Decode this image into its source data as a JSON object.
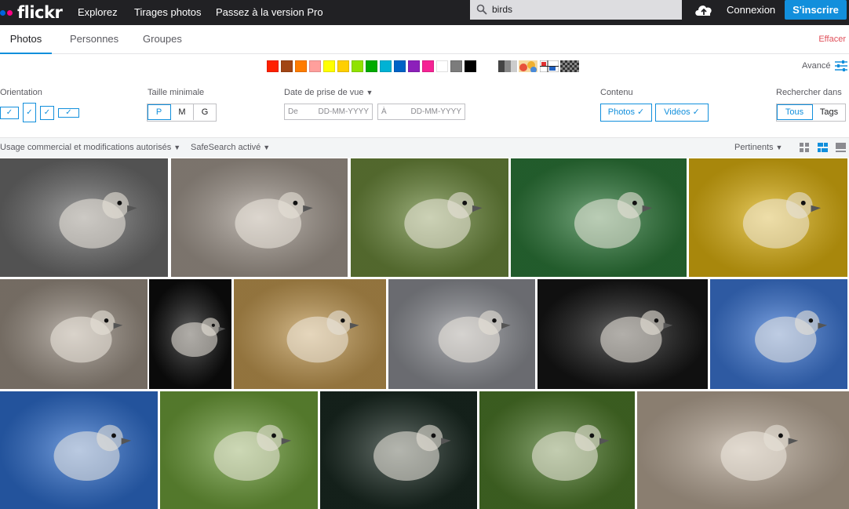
{
  "header": {
    "logo_text": "flickr",
    "nav": [
      "Explorez",
      "Tirages photos",
      "Passez à la version Pro"
    ],
    "search_value": "birds",
    "login": "Connexion",
    "signup": "S'inscrire",
    "brand_colors": {
      "blue_dot": "#0063dc",
      "pink_dot": "#ff0084",
      "accent": "#128fdc"
    }
  },
  "tabs": [
    "Photos",
    "Personnes",
    "Groupes"
  ],
  "clear_label": "Effacer",
  "color_filter": {
    "swatches": [
      "#ff2000",
      "#a24615",
      "#ff7c00",
      "#ff9f9c",
      "#ffff00",
      "#ffcf00",
      "#90e200",
      "#00ab00",
      "#00b2d4",
      "#0062c6",
      "#8c20ba",
      "#f52394",
      "#ffffff",
      "#7c7c7c",
      "#000000"
    ],
    "pattern_icons": [
      "grayscale-icon",
      "colorful-icon",
      "pattern-icon",
      "checker-icon"
    ]
  },
  "advanced_label": "Avancé",
  "filters": {
    "orientation_label": "Orientation",
    "size_label": "Taille minimale",
    "size_options": [
      "P",
      "M",
      "G"
    ],
    "date_label": "Date de prise de vue",
    "date_from_prefix": "De",
    "date_to_prefix": "À",
    "date_format": "DD-MM-YYYY",
    "content_label": "Contenu",
    "content_photos": "Photos",
    "content_videos": "Vidéos",
    "search_in_label": "Rechercher dans",
    "search_in_options": [
      "Tous",
      "Tags"
    ]
  },
  "bar": {
    "license": "Usage commercial et modifications autorisés",
    "safesearch": "SafeSearch activé",
    "sort": "Pertinents"
  },
  "photos": [
    {
      "alt_icon": "bird-photo",
      "bg": "#6e6e6e"
    },
    {
      "alt_icon": "bird-photo",
      "bg": "#a49a90"
    },
    {
      "alt_icon": "bird-photo",
      "bg": "#6d8a3c"
    },
    {
      "alt_icon": "bird-photo",
      "bg": "#2e7a3a"
    },
    {
      "alt_icon": "bird-photo",
      "bg": "#e0b410"
    },
    {
      "alt_icon": "bird-photo",
      "bg": "#9a8f83"
    },
    {
      "alt_icon": "bird-photo",
      "bg": "#0d0d0d"
    },
    {
      "alt_icon": "bird-photo",
      "bg": "#c39a52"
    },
    {
      "alt_icon": "bird-photo",
      "bg": "#8d8f95"
    },
    {
      "alt_icon": "bird-photo",
      "bg": "#151515"
    },
    {
      "alt_icon": "bird-photo",
      "bg": "#3d78d8"
    },
    {
      "alt_icon": "bird-photo",
      "bg": "#2f6fd0"
    },
    {
      "alt_icon": "bird-photo",
      "bg": "#6fa03a"
    },
    {
      "alt_icon": "bird-photo",
      "bg": "#1a2a22"
    },
    {
      "alt_icon": "bird-photo",
      "bg": "#4e7a2a"
    },
    {
      "alt_icon": "bird-photo",
      "bg": "#b8a896"
    }
  ]
}
